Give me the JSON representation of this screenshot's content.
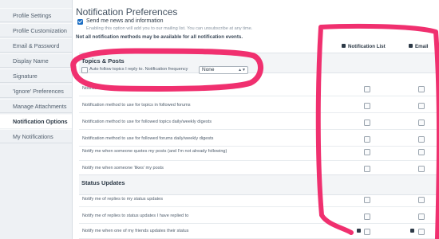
{
  "sidebar": {
    "items": [
      {
        "label": "Profile Settings",
        "active": false
      },
      {
        "label": "Profile Customization",
        "active": false
      },
      {
        "label": "Email & Password",
        "active": false
      },
      {
        "label": "Display Name",
        "active": false
      },
      {
        "label": "Signature",
        "active": false
      },
      {
        "label": "'Ignore' Preferences",
        "active": false
      },
      {
        "label": "Manage Attachments",
        "active": false
      },
      {
        "label": "Notification Options",
        "active": true
      },
      {
        "label": "My Notifications",
        "active": false
      }
    ]
  },
  "main": {
    "title": "Notification Preferences",
    "news_label": "Send me news and information",
    "news_hint": "Enabling this option will add you to our mailing list. You can unsubscribe at any time.",
    "notice": "Not all notification methods may be available for all notification events.",
    "columns": {
      "list": "Notification List",
      "email": "Email"
    },
    "topics": {
      "title": "Topics & Posts",
      "auto_follow_label": "Auto follow topics I reply to. Notification frequency",
      "frequency_value": "None",
      "rows": [
        "Notification method to use for replies to followed topics",
        "Notification method to use for topics in followed forums",
        "Notification method to use for followed topics daily/weekly digests",
        "Notification method to use for followed forums daily/weekly digests",
        "Notify me when someone quotes my posts (and I'm not already following)",
        "Notify me when someone 'likes' my posts"
      ]
    },
    "status": {
      "title": "Status Updates",
      "rows": [
        "Notify me of replies to my status updates",
        "Notify me of replies to status updates I have replied to",
        "Notify me when one of my friends updates their status"
      ]
    }
  },
  "colors": {
    "annotation": "#f0306f",
    "accent": "#1b6ec4"
  }
}
